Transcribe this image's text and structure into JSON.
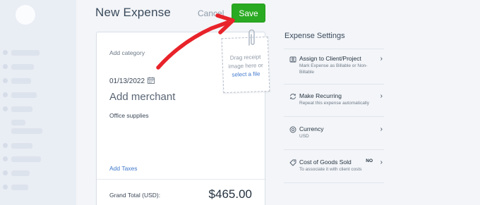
{
  "header": {
    "title": "New Expense",
    "cancel_label": "Cancel",
    "save_label": "Save"
  },
  "form": {
    "category_placeholder": "Add category",
    "date": "01/13/2022",
    "merchant_placeholder": "Add merchant",
    "description": "Office supplies",
    "add_taxes_label": "Add Taxes",
    "grand_total_label": "Grand Total (USD):",
    "grand_total_value": "$465.00"
  },
  "receipt": {
    "line1": "Drag receipt",
    "line2": "image here or",
    "link": "select a file"
  },
  "settings": {
    "title": "Expense Settings",
    "items": [
      {
        "icon": "client-icon",
        "title": "Assign to Client/Project",
        "description": "Mark Expense as Billable or Non-Billable",
        "badge": ""
      },
      {
        "icon": "recurring-icon",
        "title": "Make Recurring",
        "description": "Repeat this expense automatically",
        "badge": ""
      },
      {
        "icon": "currency-icon",
        "title": "Currency",
        "description": "USD",
        "badge": ""
      },
      {
        "icon": "goods-icon",
        "title": "Cost of Goods Sold",
        "description": "To associate it with client costs",
        "badge": "NO"
      }
    ]
  },
  "colors": {
    "save_button": "#2aaa22",
    "link": "#3f78cc",
    "annotation_arrow": "#e8232a"
  }
}
